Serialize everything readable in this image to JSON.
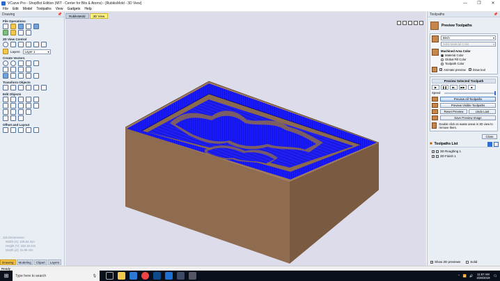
{
  "window": {
    "title": "VCarve Pro - ShopBot Edition (MIT - Center for Bits & Atoms) - [RubiksMold - 3D View]",
    "controls": [
      "—",
      "❐",
      "✕"
    ]
  },
  "menu": [
    "File",
    "Edit",
    "Model",
    "Toolpaths",
    "View",
    "Gadgets",
    "Help"
  ],
  "left": {
    "title": "Drawing",
    "sections": {
      "file_ops": "File Operations",
      "view_control": "2D View Control",
      "create_vectors": "Create Vectors",
      "transform": "Transform Objects",
      "edit": "Edit Objects",
      "offset": "Offset and Layout"
    },
    "layers_label": "Layers",
    "layer_value": "Layer 1",
    "job_dims": {
      "heading": "Job Dimensions:",
      "width": "Width  (X): 108.84 mm",
      "height": "Height (Y): 182.18 mm",
      "depth": "Depth  (Z): 31.88 mm"
    },
    "tabs": [
      "Drawing",
      "Modeling",
      "Clipart",
      "Layers"
    ]
  },
  "viewport": {
    "tabs": [
      "RubiksMold",
      "3D View"
    ],
    "bg": "#dcdcea",
    "wood": "#8f6b4f",
    "toolpath": "#1a1aff"
  },
  "right": {
    "title": "Toolpaths",
    "preview_title": "Preview Toolpaths",
    "material": "Birch",
    "solid_color": "Solid Material Color",
    "machined_area": "Machined Area Color",
    "radios": [
      "Material Color",
      "Global Fill Color",
      "Toolpath Color"
    ],
    "animate": "Animate preview",
    "draw_tool": "Draw tool",
    "selected_title": "Preview Selected Toolpath",
    "play_controls": [
      "▶",
      "❚❚",
      "▶|",
      "▶▶",
      "■"
    ],
    "speed": "Speed",
    "speed_level": 1.0,
    "btn_all": "Preview All Toolpaths",
    "btn_visible": "Preview Visible Toolpaths",
    "btn_reset": "Reset Preview",
    "btn_undo": "Undo Last",
    "btn_save": "Save Preview Image",
    "hint": "Double click on waste areas in 3D view to remove them.",
    "btn_close": "Close",
    "list_title": "Toolpaths List",
    "toolpaths": [
      "3D Roughing 1",
      "3D Finish 1"
    ],
    "show_previews": "Show 2D previews",
    "solid": "Solid"
  },
  "status": "Ready",
  "taskbar": {
    "search": "Type here to search",
    "time": "11:57 AM",
    "date": "3/28/2019"
  }
}
